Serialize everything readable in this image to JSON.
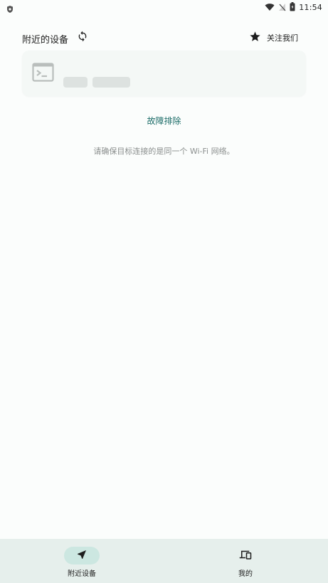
{
  "status_bar": {
    "time": "11:54"
  },
  "header": {
    "title": "附近的设备",
    "follow_label": "关注我们"
  },
  "main": {
    "troubleshoot_label": "故障排除",
    "hint": "请确保目标连接的是同一个 Wi-Fi 网络。"
  },
  "bottom_nav": {
    "items": [
      {
        "label": "附近设备",
        "icon": "navigation-arrow-icon",
        "active": true
      },
      {
        "label": "我的",
        "icon": "devices-icon",
        "active": false
      }
    ]
  },
  "colors": {
    "accent": "#1d6d69",
    "active_pill": "#cce7e1",
    "nav_background": "#e6efec",
    "card_background": "#f4f8f6",
    "skeleton": "#dde2e0"
  }
}
